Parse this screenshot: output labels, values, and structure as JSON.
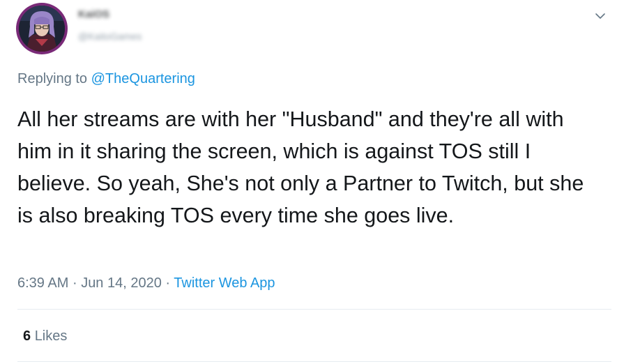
{
  "tweet": {
    "author": {
      "name": "KaiOS",
      "handle": "@KaitoGames",
      "avatar": "avatar-image"
    },
    "menu_icon": "chevron-down-icon",
    "replying_prefix": "Replying to",
    "replying_to": "@TheQuartering",
    "text": "All her streams are with her \"Husband\" and they're all with him in it sharing the screen, which is against TOS still I believe. So yeah, She's not only a Partner to Twitch, but she is also breaking TOS every time she goes live.",
    "time": "6:39 AM",
    "separator": "·",
    "date": "Jun 14, 2020",
    "source": "Twitter Web App",
    "likes_count": "6",
    "likes_label": "Likes"
  },
  "colors": {
    "link": "#1b95e0",
    "secondary_text": "#657786",
    "primary_text": "#14171a",
    "divider": "#e6ecf0",
    "avatar_ring": "#7a2a78"
  }
}
